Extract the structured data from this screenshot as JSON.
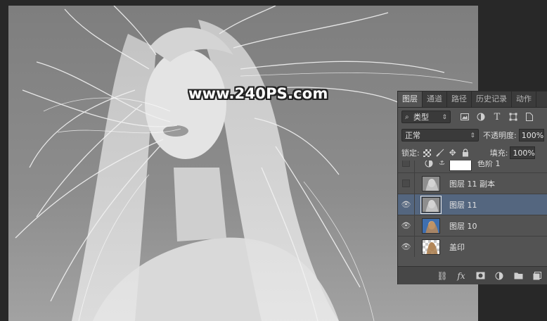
{
  "canvas": {
    "watermark": "www.240PS.com"
  },
  "layers_panel": {
    "tabs": [
      {
        "label": "图层",
        "active": true
      },
      {
        "label": "通道",
        "active": false
      },
      {
        "label": "路径",
        "active": false
      },
      {
        "label": "历史记录",
        "active": false
      },
      {
        "label": "动作",
        "active": false
      }
    ],
    "filter": {
      "label": "类型"
    },
    "filter_icons": [
      "image-filter-icon",
      "adjustment-filter-icon",
      "type-filter-icon",
      "shape-filter-icon",
      "smart-object-filter-icon"
    ],
    "blend_mode": "正常",
    "opacity_label": "不透明度:",
    "opacity_value": "100%",
    "lock_label": "锁定:",
    "fill_label": "填充:",
    "fill_value": "100%",
    "layers": [
      {
        "name": "色阶 1",
        "visible": false,
        "selected": false,
        "type": "adjustment"
      },
      {
        "name": "图层 11 副本",
        "visible": false,
        "selected": false,
        "type": "bw"
      },
      {
        "name": "图层 11",
        "visible": true,
        "selected": true,
        "type": "bw"
      },
      {
        "name": "图层 10",
        "visible": true,
        "selected": false,
        "type": "color"
      },
      {
        "name": "盖印",
        "visible": true,
        "selected": false,
        "type": "transparent"
      }
    ],
    "colors": {
      "selected_row": "#54667f",
      "panel_bg": "#535353"
    }
  }
}
